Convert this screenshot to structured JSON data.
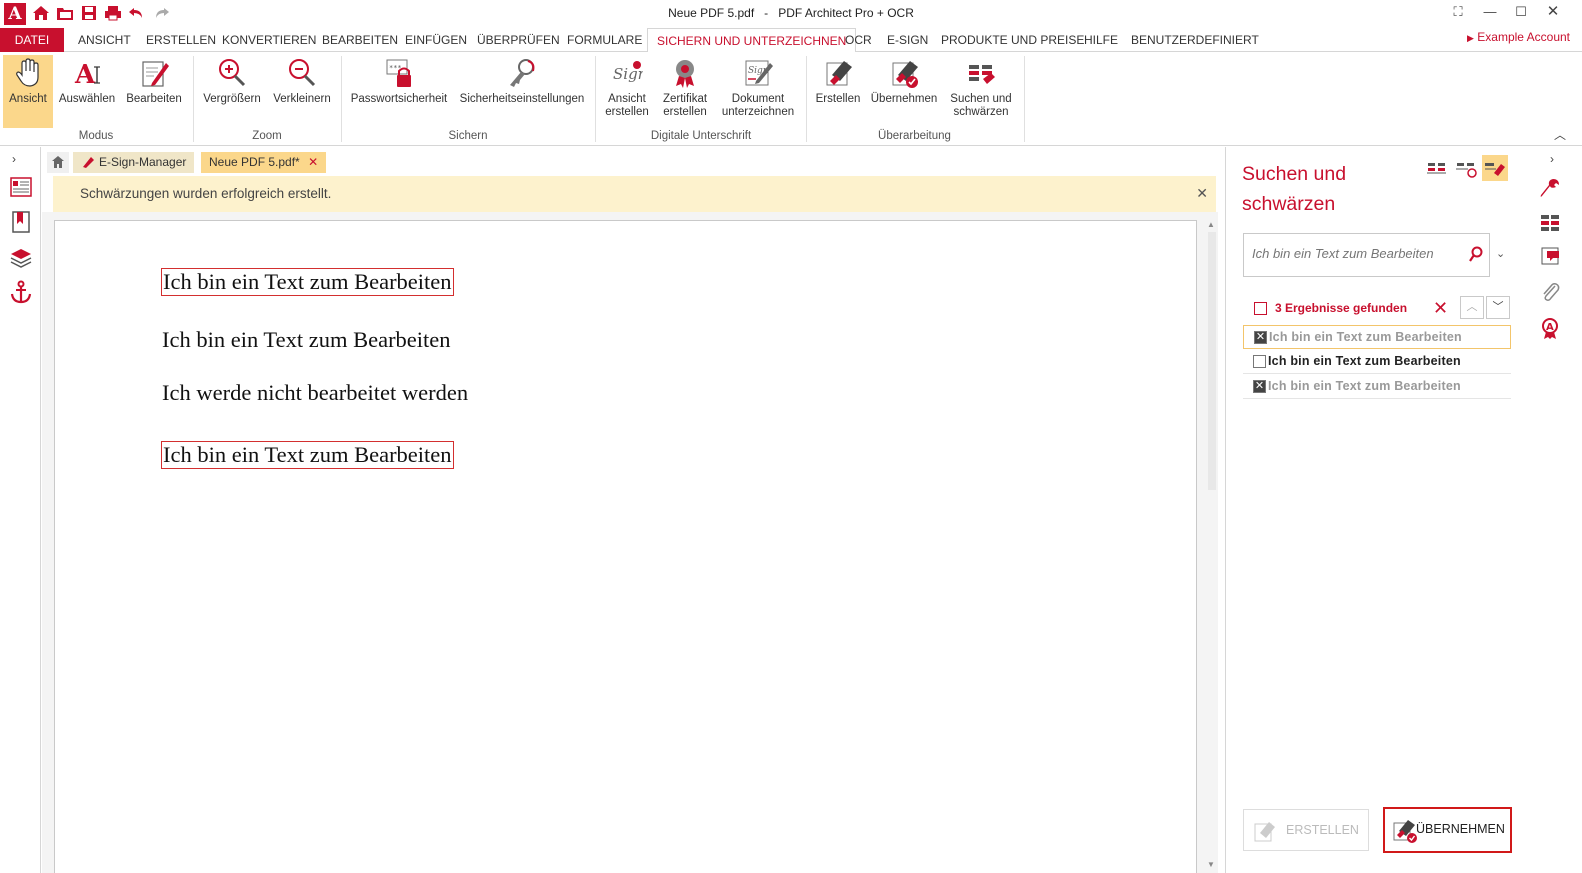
{
  "titlebar": {
    "file": "Neue PDF 5.pdf",
    "separator": "-",
    "app": "PDF Architect Pro + OCR",
    "logo_letter": "A"
  },
  "menu": {
    "tabs": [
      "DATEI",
      "ANSICHT",
      "ERSTELLEN",
      "KONVERTIEREN",
      "BEARBEITEN",
      "EINFÜGEN",
      "ÜBERPRÜFEN",
      "FORMULARE",
      "SICHERN UND UNTERZEICHNEN",
      "OCR",
      "E-SIGN",
      "PRODUKTE UND PREISE",
      "HILFE",
      "BENUTZERDEFINIERT"
    ],
    "active": "SICHERN UND UNTERZEICHNEN",
    "account": "Example Account"
  },
  "ribbon": {
    "modus": {
      "label": "Modus",
      "buttons": [
        "Ansicht",
        "Auswählen",
        "Bearbeiten"
      ]
    },
    "zoom": {
      "label": "Zoom",
      "buttons": [
        "Vergrößern",
        "Verkleinern"
      ]
    },
    "sichern": {
      "label": "Sichern",
      "buttons": [
        "Passwortsicherheit",
        "Sicherheitseinstellungen"
      ]
    },
    "digital": {
      "label": "Digitale Unterschrift",
      "buttons": [
        [
          "Ansicht",
          "erstellen"
        ],
        [
          "Zertifikat",
          "erstellen"
        ],
        [
          "Dokument",
          "unterzeichnen"
        ]
      ]
    },
    "ueberarbeitung": {
      "label": "Überarbeitung",
      "buttons": [
        [
          "Erstellen"
        ],
        [
          "Übernehmen"
        ],
        [
          "Suchen und",
          "schwärzen"
        ]
      ]
    }
  },
  "doctabs": {
    "esign": "E-Sign-Manager",
    "active": "Neue PDF 5.pdf*"
  },
  "notification": "Schwärzungen wurden erfolgreich erstellt.",
  "document": {
    "lines": [
      "Ich bin ein Text zum Bearbeiten",
      "Ich bin ein Text zum Bearbeiten",
      "Ich werde nicht bearbeitet werden",
      "Ich bin ein Text zum Bearbeiten"
    ]
  },
  "panel": {
    "title_line1": "Suchen und",
    "title_line2": "schwärzen",
    "search_placeholder": "Ich bin ein Text zum Bearbeiten",
    "results_count": "3 Ergebnisse gefunden",
    "results": [
      {
        "text": "Ich bin ein Text zum Bearbeiten",
        "checked": true
      },
      {
        "text": "Ich bin ein Text zum Bearbeiten",
        "checked": false
      },
      {
        "text": "Ich bin ein Text zum Bearbeiten",
        "checked": true
      }
    ],
    "btn_create": "ERSTELLEN",
    "btn_apply": "ÜBERNEHMEN"
  },
  "colors": {
    "accent": "#c8102e",
    "highlight": "#fbd78b",
    "notification_bg": "#fdf2cd"
  }
}
